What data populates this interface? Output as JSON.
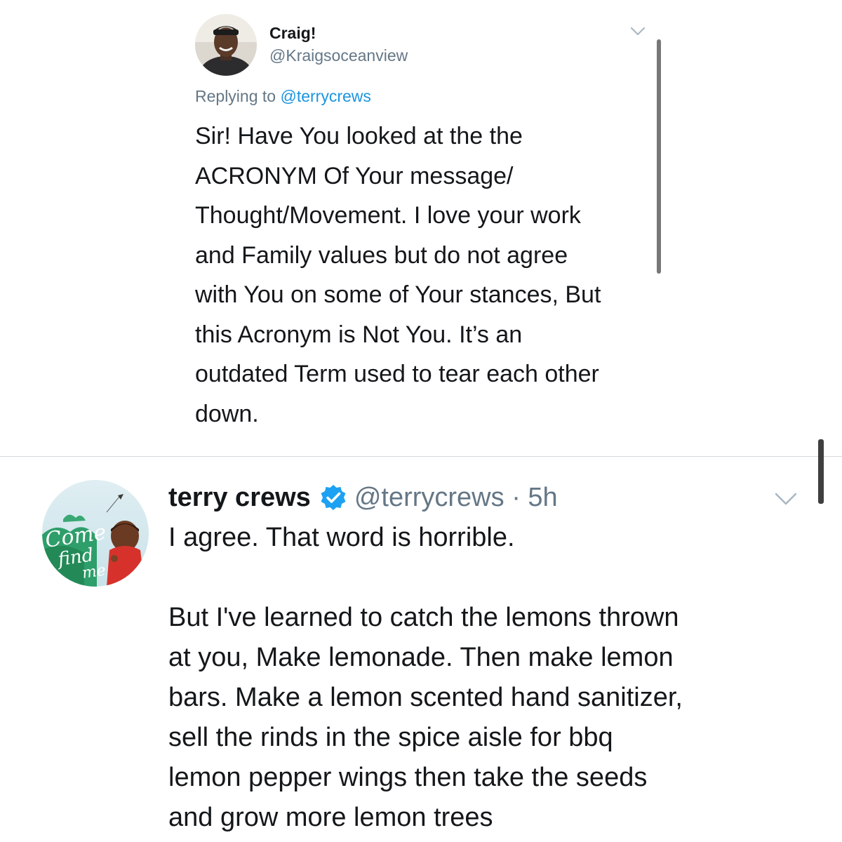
{
  "reply_tweet": {
    "display_name": "Craig!",
    "handle": "@Kraigsoceanview",
    "replying_prefix": "Replying to",
    "replying_to": "@terrycrews",
    "body_lines": [
      "Sir! Have You looked at the the",
      "ACRONYM Of Your message/",
      "Thought/Movement.  I love your work",
      "and Family values but do not agree",
      "with You on some of Your stances,  But",
      "this Acronym is Not You. It’s an",
      "outdated Term used to tear each other",
      "down."
    ]
  },
  "main_tweet": {
    "display_name": "terry crews",
    "handle": "@terrycrews",
    "separator": "·",
    "time": "5h",
    "avatar_text": [
      "Come",
      "find",
      "me"
    ],
    "body_line_1": "I agree. That word is horrible.",
    "body_paragraph_2": [
      "But I've learned to catch the lemons thrown",
      "at you, Make lemonade. Then make lemon",
      "bars. Make a lemon scented hand sanitizer,",
      "sell the rinds in the spice aisle for bbq",
      "lemon pepper wings then take the seeds",
      "and grow more lemon trees"
    ]
  },
  "colors": {
    "text": "#14171a",
    "secondary": "#657786",
    "link": "#1b95e0",
    "verified": "#1da1f2",
    "divider": "#d4d9dd"
  },
  "icons": [
    "chevron-down-icon",
    "verified-badge-icon"
  ]
}
